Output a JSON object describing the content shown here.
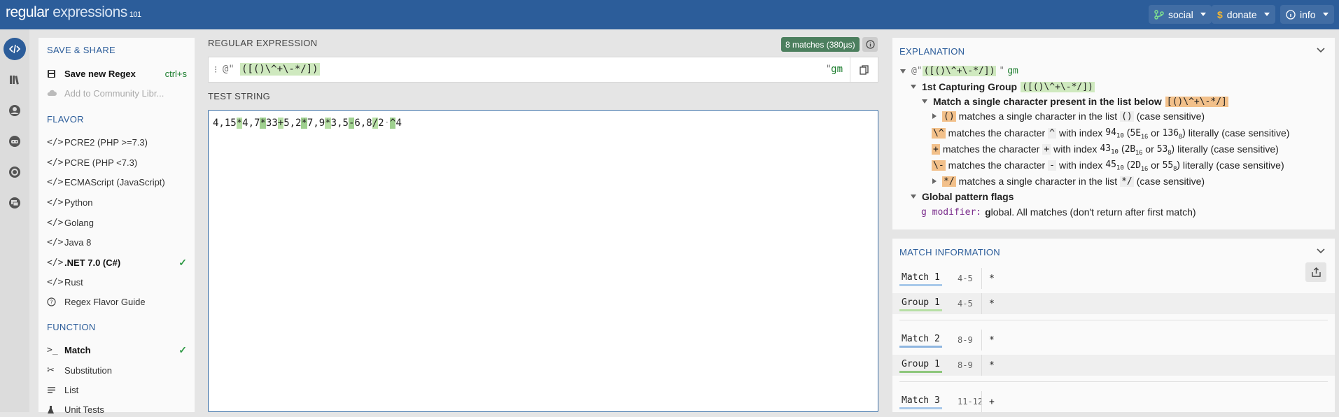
{
  "header": {
    "logo_main": "regular",
    "logo_rest": " expressions",
    "logo_version": "101",
    "buttons": [
      {
        "label": "social",
        "icon": "branch-icon"
      },
      {
        "label": "donate",
        "icon": "dollar-icon"
      },
      {
        "label": "info",
        "icon": "info-icon"
      }
    ]
  },
  "rail": [
    "code-icon",
    "library-icon",
    "user-icon",
    "game-icon",
    "settings-icon",
    "chat-icon"
  ],
  "sidebar": {
    "save_share": {
      "heading": "SAVE & SHARE",
      "save_label": "Save new Regex",
      "save_shortcut": "ctrl+s",
      "community_label": "Add to Community Libr..."
    },
    "flavor": {
      "heading": "FLAVOR",
      "items": [
        {
          "label": "PCRE2 (PHP >=7.3)",
          "selected": false
        },
        {
          "label": "PCRE (PHP <7.3)",
          "selected": false
        },
        {
          "label": "ECMAScript (JavaScript)",
          "selected": false
        },
        {
          "label": "Python",
          "selected": false
        },
        {
          "label": "Golang",
          "selected": false
        },
        {
          "label": "Java 8",
          "selected": false
        },
        {
          "label": ".NET 7.0 (C#)",
          "selected": true
        },
        {
          "label": "Rust",
          "selected": false
        }
      ],
      "guide_label": "Regex Flavor Guide"
    },
    "function": {
      "heading": "FUNCTION",
      "items": [
        {
          "label": "Match",
          "selected": true,
          "icon": "terminal-icon"
        },
        {
          "label": "Substitution",
          "selected": false,
          "icon": "scissors-icon"
        },
        {
          "label": "List",
          "selected": false,
          "icon": "list-icon"
        },
        {
          "label": "Unit Tests",
          "selected": false,
          "icon": "flask-icon"
        }
      ]
    }
  },
  "regex": {
    "heading": "REGULAR EXPRESSION",
    "match_badge": "8 matches (380µs)",
    "prefix": "@\"",
    "pattern": "([()\\^+\\-*/])",
    "suffix": "\"",
    "flags": "gm"
  },
  "test": {
    "heading": "TEST STRING",
    "segments": [
      {
        "t": "4,15",
        "m": 0
      },
      {
        "t": "*",
        "m": 1
      },
      {
        "t": "4,7",
        "m": 0
      },
      {
        "t": "*",
        "m": 2
      },
      {
        "t": "33",
        "m": 0
      },
      {
        "t": "+",
        "m": 1
      },
      {
        "t": "5,2",
        "m": 0
      },
      {
        "t": "*",
        "m": 2
      },
      {
        "t": "7,9",
        "m": 0
      },
      {
        "t": "*",
        "m": 1
      },
      {
        "t": "3,5",
        "m": 0
      },
      {
        "t": "-",
        "m": 2
      },
      {
        "t": "6,8",
        "m": 0
      },
      {
        "t": "/",
        "m": 1
      },
      {
        "t": "2",
        "m": 0
      },
      {
        "t": "·",
        "m": 3
      },
      {
        "t": "^",
        "m": 2
      },
      {
        "t": "4",
        "m": 0
      }
    ]
  },
  "explanation": {
    "heading": "EXPLANATION",
    "root_prefix": "@\"",
    "root_pattern": "([()\\^+\\-*/])",
    "root_suffix": "\"",
    "root_flags": "gm",
    "group_label": "1st Capturing Group",
    "group_token": "([()\\^+\\-*/])",
    "set_label": "Match a single character present in the list below",
    "set_token": "[()\\^+\\-*/]",
    "line1_token": "()",
    "line1_text": "matches a single character in the list",
    "line1_code": "()",
    "line1_tail": "(case sensitive)",
    "line2_token": "\\^",
    "line2_a": "matches the character",
    "line2_char": "^",
    "line2_b": "with index",
    "line2_dec": "94",
    "line2_hex": "5E",
    "line2_oct": "136",
    "line3_token": "+",
    "line3_a": "matches the character",
    "line3_char": "+",
    "line3_b": "with index",
    "line3_dec": "43",
    "line3_hex": "2B",
    "line3_oct": "53",
    "line4_token": "\\-",
    "line4_a": "matches the character",
    "line4_char": "-",
    "line4_b": "with index",
    "line4_dec": "45",
    "line4_hex": "2D",
    "line4_oct": "55",
    "line5_token": "*/",
    "line5_text": "matches a single character in the list",
    "line5_code": "*/",
    "line5_tail": "(case sensitive)",
    "lit_tail": "literally (case sensitive)",
    "or_word": "or",
    "sub10": "10",
    "sub16": "16",
    "sub8": "8",
    "flags_label": "Global pattern flags",
    "g_mod": "g modifier:",
    "g_bold": "g",
    "g_text": "lobal. All matches (don't return after first match)"
  },
  "match_info": {
    "heading": "MATCH INFORMATION",
    "rows": [
      {
        "name": "Match 1",
        "range": "4-5",
        "value": "*"
      },
      {
        "name": "Group 1",
        "range": "4-5",
        "value": "*"
      },
      {
        "name": "Match 2",
        "range": "8-9",
        "value": "*"
      },
      {
        "name": "Group 1",
        "range": "8-9",
        "value": "*"
      },
      {
        "name": "Match 3",
        "range": "11-12",
        "value": "+"
      }
    ]
  }
}
